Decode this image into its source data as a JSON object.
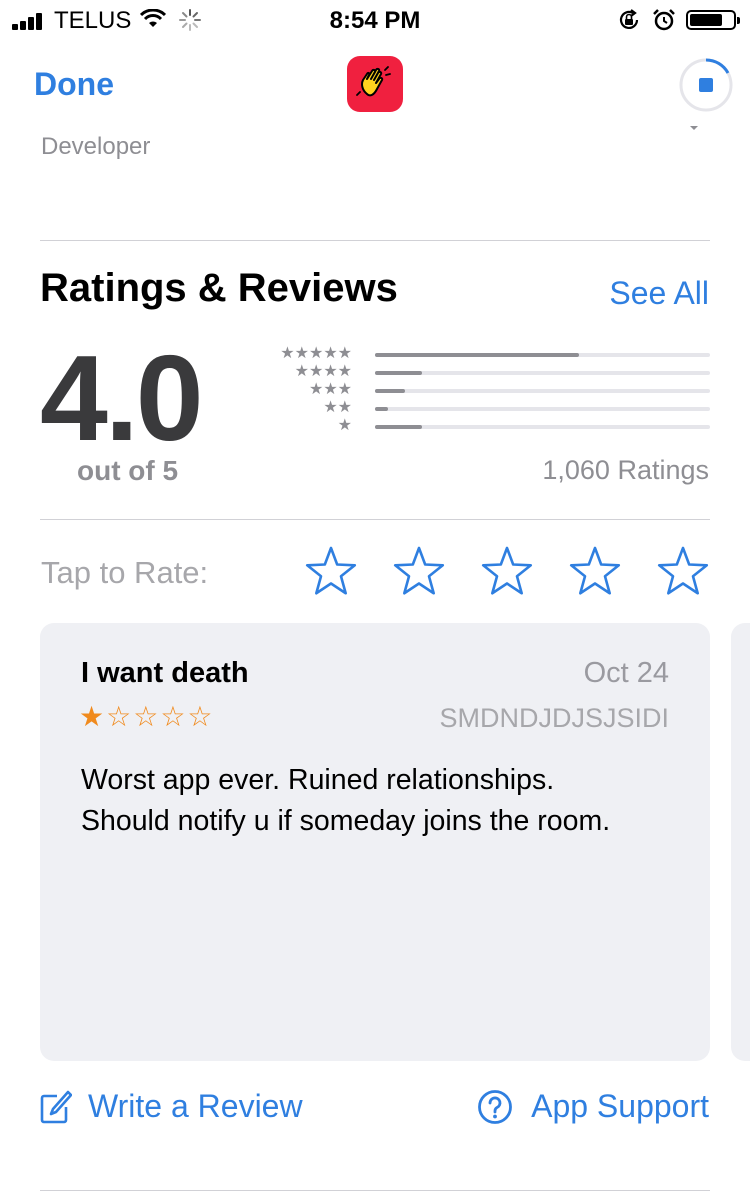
{
  "status_bar": {
    "carrier": "TELUS",
    "time": "8:54 PM",
    "icons": [
      "signal-icon",
      "wifi-icon",
      "activity-spinner-icon",
      "rotation-lock-icon",
      "alarm-icon",
      "battery-icon"
    ]
  },
  "nav": {
    "done_label": "Done",
    "app_icon": "waving-hand-icon",
    "stop_icon": "stop-download-icon"
  },
  "developer_label": "Developer",
  "ratings": {
    "title": "Ratings & Reviews",
    "see_all": "See All",
    "average": "4.0",
    "out_of": "out of 5",
    "count_label": "1,060 Ratings",
    "distribution": [
      {
        "stars": 5,
        "fraction": 0.61
      },
      {
        "stars": 4,
        "fraction": 0.14
      },
      {
        "stars": 3,
        "fraction": 0.09
      },
      {
        "stars": 2,
        "fraction": 0.04
      },
      {
        "stars": 1,
        "fraction": 0.14
      }
    ]
  },
  "tap_to_rate": {
    "label": "Tap to Rate:",
    "star_count": 5
  },
  "review": {
    "title": "I want death",
    "date": "Oct 24",
    "stars": 1,
    "max_stars": 5,
    "author": "SMDNDJDJSJSIDI",
    "body_line1": "Worst app ever. Ruined relationships.",
    "body_line2": "Should notify u if someday joins the room."
  },
  "actions": {
    "write_review": "Write a Review",
    "app_support": "App Support"
  },
  "colors": {
    "accent": "#2f7fe0",
    "review_star": "#f08a1d",
    "app_icon_bg": "#f0203f",
    "card_bg": "#eff0f4"
  }
}
